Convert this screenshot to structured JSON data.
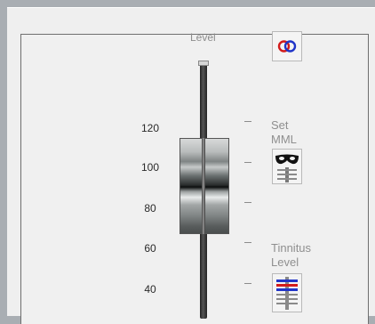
{
  "fader": {
    "title": "Level",
    "scale": [
      "120",
      "100",
      "80",
      "60",
      "40"
    ]
  },
  "buttons": {
    "link": {
      "icon": "linked-rings-icon"
    },
    "set_mml": {
      "label": "Set\nMML",
      "icon": "mask-icon"
    },
    "tinnitus_level": {
      "label": "Tinnitus\nLevel",
      "icon": "tinnitus-bars-icon"
    }
  }
}
